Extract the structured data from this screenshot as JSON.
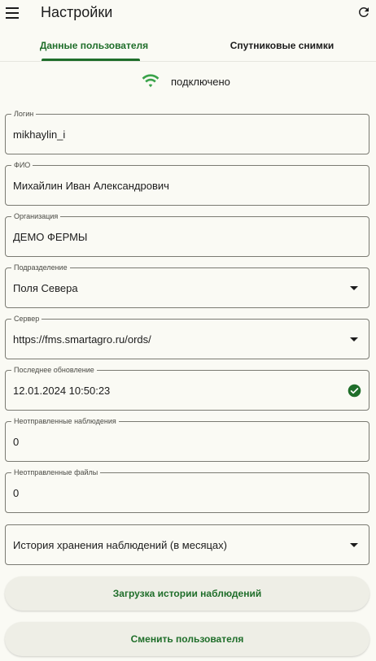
{
  "appbar": {
    "title": "Настройки"
  },
  "tabs": [
    {
      "label": "Данные пользователя"
    },
    {
      "label": "Спутниковые снимки"
    }
  ],
  "connection": {
    "status": "подключено"
  },
  "fields": {
    "login": {
      "label": "Логин",
      "value": "mikhaylin_i"
    },
    "fio": {
      "label": "ФИО",
      "value": "Михайлин Иван Александрович"
    },
    "organization": {
      "label": "Организация",
      "value": "ДЕМО ФЕРМЫ"
    },
    "division": {
      "label": "Подразделение",
      "value": "Поля Севера"
    },
    "server": {
      "label": "Сервер",
      "value": "https://fms.smartagro.ru/ords/"
    },
    "last_update": {
      "label": "Последнее обновление",
      "value": "12.01.2024 10:50:23"
    },
    "unsent_observations": {
      "label": "Неотправленные наблюдения",
      "value": "0"
    },
    "unsent_files": {
      "label": "Неотправленные файлы",
      "value": "0"
    },
    "history_retention": {
      "placeholder": "История хранения наблюдений (в месяцах)"
    }
  },
  "buttons": {
    "load_history": "Загрузка истории наблюдений",
    "change_user": "Сменить пользователя"
  },
  "colors": {
    "accent": "#1f6e2a",
    "wifi": "#3aa34a",
    "background": "#fafaf4"
  },
  "icons": [
    "menu-icon",
    "refresh-icon",
    "wifi-icon",
    "check-circle-icon",
    "chevron-down-icon"
  ]
}
